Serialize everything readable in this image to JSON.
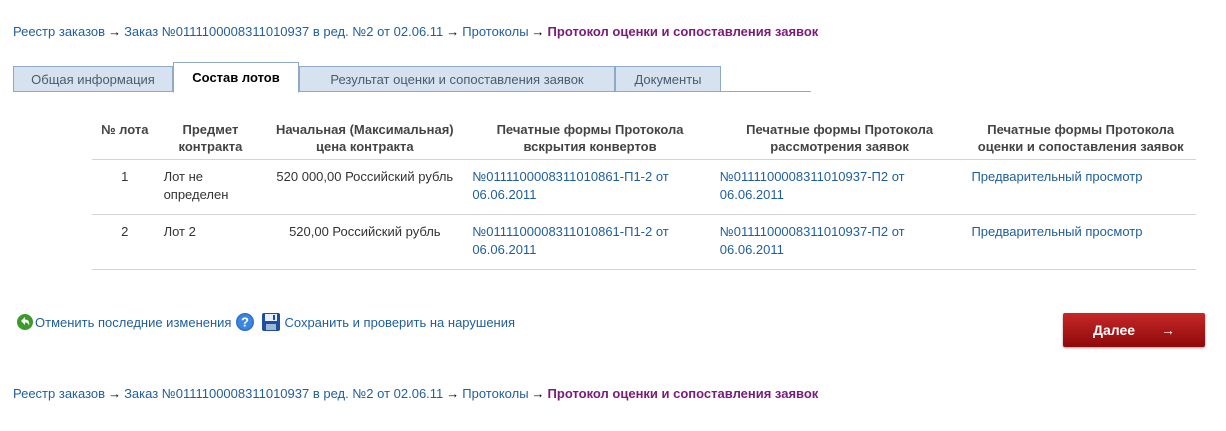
{
  "breadcrumb": {
    "registry": "Реестр заказов",
    "order": "Заказ №0111100008311010937 в ред. №2 от 02.06.11",
    "protocols": "Протоколы",
    "current": "Протокол оценки и сопоставления заявок",
    "arrow": "→"
  },
  "tabs": [
    {
      "label": "Общая информация",
      "active": false
    },
    {
      "label": "Состав лотов",
      "active": true
    },
    {
      "label": "Результат оценки и сопоставления заявок",
      "active": false
    },
    {
      "label": "Документы",
      "active": false
    }
  ],
  "table": {
    "headers": {
      "num": "№ лота",
      "subject": "Предмет контракта",
      "price": "Начальная (Максимальная) цена контракта",
      "forms_opening": "Печатные формы Протокола вскрытия конвертов",
      "forms_review": "Печатные формы Протокола рассмотрения заявок",
      "forms_evaluation": "Печатные формы Протокола оценки и сопоставления заявок"
    },
    "rows": [
      {
        "num": "1",
        "subject": "Лот не определен",
        "price": "520 000,00 Российский рубль",
        "form_opening": "№0111100008311010861-П1-2 от 06.06.2011",
        "form_review": "№0111100008311010937-П2 от 06.06.2011",
        "form_evaluation": "Предварительный просмотр"
      },
      {
        "num": "2",
        "subject": "Лот 2",
        "price": "520,00 Российский рубль",
        "form_opening": "№0111100008311010861-П1-2 от 06.06.2011",
        "form_review": "№0111100008311010937-П2 от 06.06.2011",
        "form_evaluation": "Предварительный просмотр"
      }
    ]
  },
  "actions": {
    "undo": "Отменить последние изменения",
    "save": "Сохранить и проверить на нарушения",
    "next": "Далее",
    "next_arrow": "→"
  },
  "colors": {
    "link": "#1f5e9e",
    "current": "#7a1a7a",
    "tab_bg": "#d6e2ef",
    "next_button": "#b01818"
  },
  "icons": {
    "undo": "undo-icon",
    "help": "help-icon",
    "save": "save-icon"
  }
}
